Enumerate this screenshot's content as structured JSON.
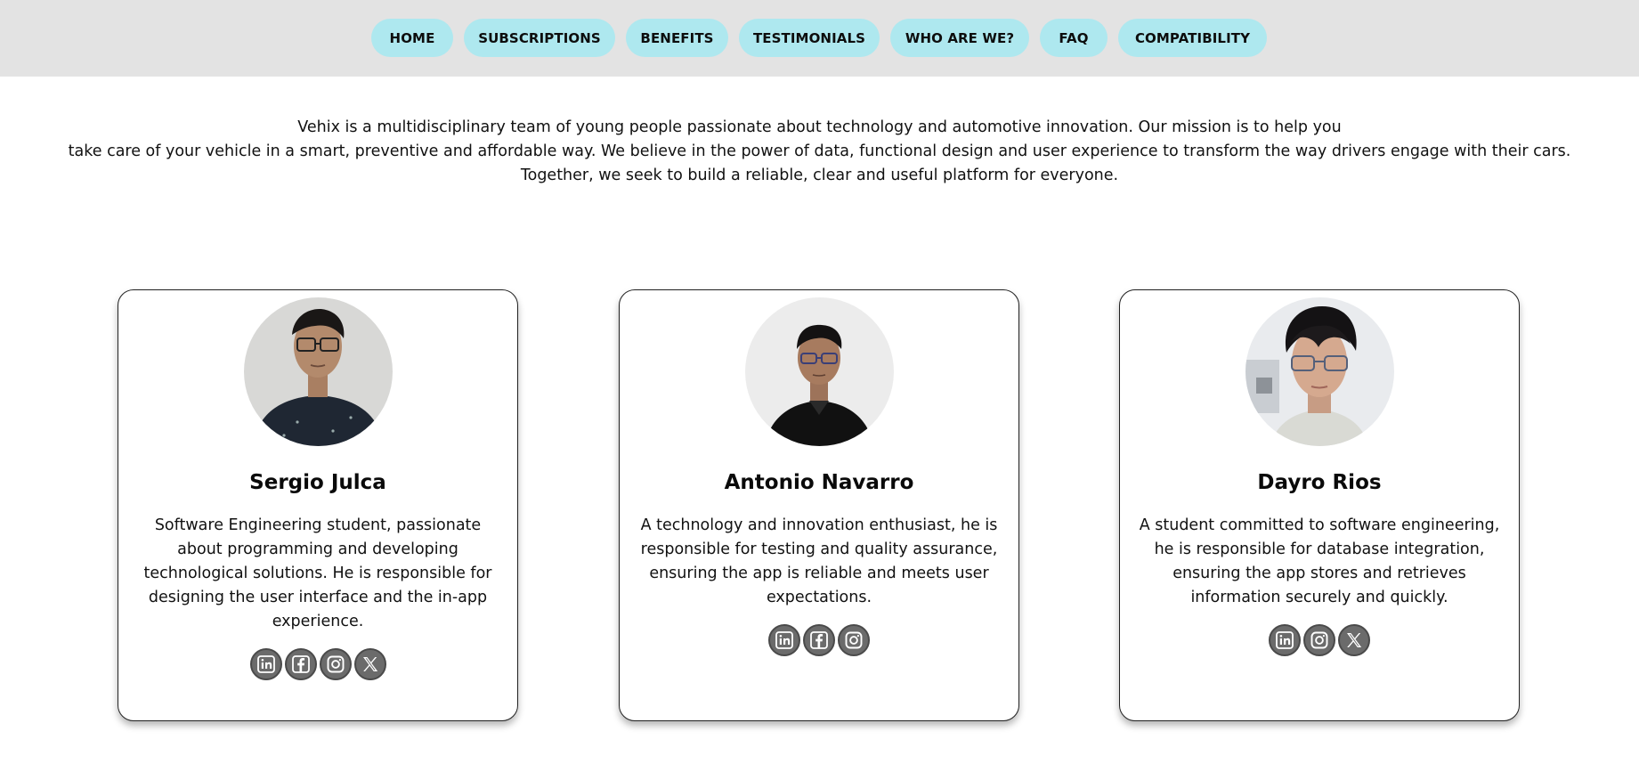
{
  "nav": {
    "items": [
      {
        "label": "HOME"
      },
      {
        "label": "SUBSCRIPTIONS"
      },
      {
        "label": "BENEFITS"
      },
      {
        "label": "TESTIMONIALS"
      },
      {
        "label": "WHO ARE WE?"
      },
      {
        "label": "FAQ"
      },
      {
        "label": "COMPATIBILITY"
      }
    ]
  },
  "intro": {
    "line1": "Vehix is a multidisciplinary team of young people passionate about technology and automotive innovation. Our mission is to help you",
    "line2": "take care of your vehicle in a smart, preventive and affordable way. We believe in the power of data, functional design and user experience to transform the way drivers engage with their cars.",
    "line3": "Together, we seek to build a reliable, clear and useful platform for everyone."
  },
  "team": [
    {
      "name": "Sergio Julca",
      "desc": "Software Engineering student, passionate about programming and developing technological solutions. He is responsible for designing the user interface and the in-app experience.",
      "socials": [
        "linkedin-icon",
        "facebook-icon",
        "instagram-icon",
        "x-icon"
      ]
    },
    {
      "name": "Antonio Navarro",
      "desc": "A technology and innovation enthusiast, he is responsible for testing and quality assurance, ensuring the app is reliable and meets user expectations.",
      "socials": [
        "linkedin-icon",
        "facebook-icon",
        "instagram-icon"
      ]
    },
    {
      "name": "Dayro Rios",
      "desc": "A student committed to software engineering, he is responsible for database integration, ensuring the app stores and retrieves information securely and quickly.",
      "socials": [
        "linkedin-icon",
        "instagram-icon",
        "x-icon"
      ]
    }
  ],
  "colors": {
    "nav_bg": "#e3e3e3",
    "nav_button": "#aee8ef",
    "social_icon_bg": "#6b6b6b"
  }
}
